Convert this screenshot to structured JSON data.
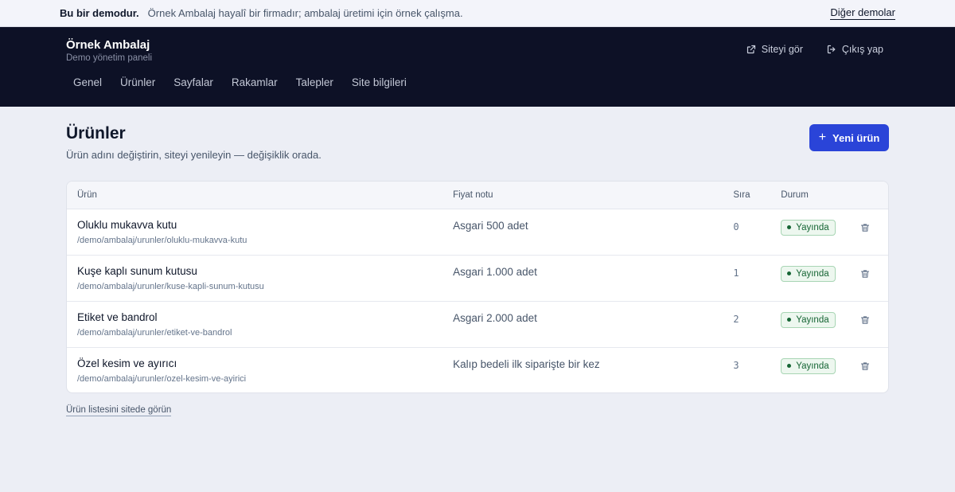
{
  "banner": {
    "strong": "Bu bir demodur.",
    "text": "Örnek Ambalaj hayalî bir firmadır; ambalaj üretimi için örnek çalışma.",
    "link": "Diğer demolar"
  },
  "header": {
    "brand_title": "Örnek Ambalaj",
    "brand_sub": "Demo yönetim paneli",
    "actions": [
      {
        "label": "Siteyi gör",
        "icon": "external-link-icon"
      },
      {
        "label": "Çıkış yap",
        "icon": "logout-icon"
      }
    ],
    "nav": [
      "Genel",
      "Ürünler",
      "Sayfalar",
      "Rakamlar",
      "Talepler",
      "Site bilgileri"
    ]
  },
  "main": {
    "title": "Ürünler",
    "description": "Ürün adını değiştirin, siteyi yenileyin — değişiklik orada.",
    "new_button": "Yeni ürün",
    "columns": [
      "Ürün",
      "Fiyat notu",
      "Sıra",
      "Durum"
    ],
    "rows": [
      {
        "name": "Oluklu mukavva kutu",
        "path": "/demo/ambalaj/urunler/oluklu-mukavva-kutu",
        "price": "Asgari 500 adet",
        "order": "0",
        "status": "Yayında"
      },
      {
        "name": "Kuşe kaplı sunum kutusu",
        "path": "/demo/ambalaj/urunler/kuse-kapli-sunum-kutusu",
        "price": "Asgari 1.000 adet",
        "order": "1",
        "status": "Yayında"
      },
      {
        "name": "Etiket ve bandrol",
        "path": "/demo/ambalaj/urunler/etiket-ve-bandrol",
        "price": "Asgari 2.000 adet",
        "order": "2",
        "status": "Yayında"
      },
      {
        "name": "Özel kesim ve ayırıcı",
        "path": "/demo/ambalaj/urunler/ozel-kesim-ve-ayirici",
        "price": "Kalıp bedeli ilk siparişte bir kez",
        "order": "3",
        "status": "Yayında"
      }
    ],
    "bottom_link": "Ürün listesini sitede görün"
  },
  "colors": {
    "header_bg": "#0d1126",
    "accent": "#2a44d8",
    "status_green": "#166534"
  }
}
